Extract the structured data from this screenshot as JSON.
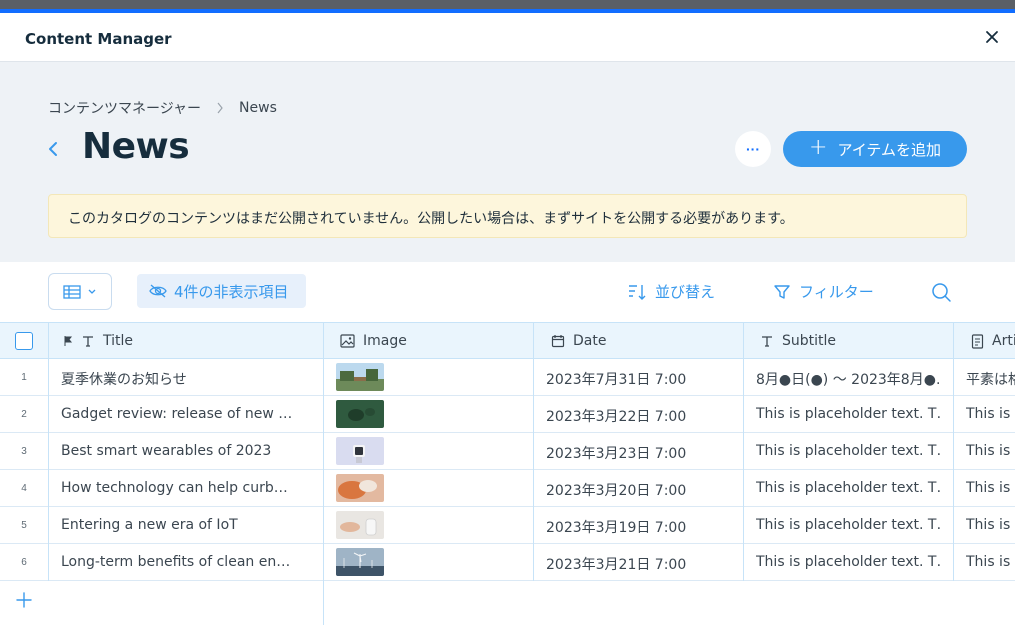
{
  "window": {
    "title": "Content Manager"
  },
  "breadcrumb": {
    "root": "コンテンツマネージャー",
    "current": "News"
  },
  "page": {
    "title": "News",
    "more_label": "···",
    "add_label": "アイテムを追加"
  },
  "notice": {
    "text": "このカタログのコンテンツはまだ公開されていません。公開したい場合は、まずサイトを公開する必要があります。"
  },
  "toolbar": {
    "hidden_label": "4件の非表示項目",
    "sort_label": "並び替え",
    "filter_label": "フィルター"
  },
  "table": {
    "columns": [
      {
        "label": "Title",
        "icon": "text-icon"
      },
      {
        "label": "Image",
        "icon": "image-icon"
      },
      {
        "label": "Date",
        "icon": "calendar-icon"
      },
      {
        "label": "Subtitle",
        "icon": "text-icon"
      },
      {
        "label": "Arti",
        "icon": "document-icon"
      }
    ],
    "rows": [
      {
        "num": "1",
        "title": "夏季休業のお知らせ",
        "date": "2023年7月31日 7:00",
        "subtitle": "8月●日(●) ～ 2023年8月●…",
        "article": "平素は格"
      },
      {
        "num": "2",
        "title": "Gadget review: release of new …",
        "date": "2023年3月22日 7:00",
        "subtitle": "This is placeholder text. T…",
        "article": "This is p"
      },
      {
        "num": "3",
        "title": "Best smart wearables of 2023",
        "date": "2023年3月23日 7:00",
        "subtitle": "This is placeholder text. T…",
        "article": "This is p"
      },
      {
        "num": "4",
        "title": "How technology can help curb…",
        "date": "2023年3月20日 7:00",
        "subtitle": "This is placeholder text. T…",
        "article": "This is p"
      },
      {
        "num": "5",
        "title": "Entering a new era of IoT",
        "date": "2023年3月19日 7:00",
        "subtitle": "This is placeholder text. T…",
        "article": "This is p"
      },
      {
        "num": "6",
        "title": "Long-term benefits of clean en…",
        "date": "2023年3月21日 7:00",
        "subtitle": "This is placeholder text. T…",
        "article": "This is p"
      }
    ]
  },
  "colors": {
    "accent": "#3899ec",
    "brand_blue": "#116dff",
    "notice_bg": "#fdf6dc",
    "header_bg": "#eaf5fd"
  }
}
